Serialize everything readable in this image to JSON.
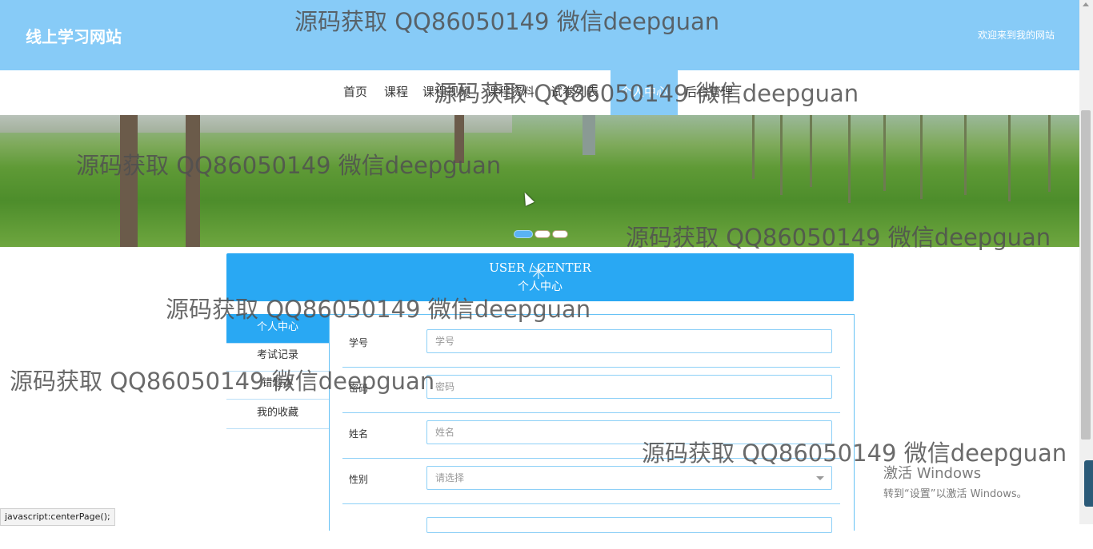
{
  "header": {
    "site_title": "线上学习网站",
    "welcome": "欢迎来到我的网站"
  },
  "nav": {
    "items": [
      {
        "label": "首页"
      },
      {
        "label": "课程"
      },
      {
        "label": "课程视频"
      },
      {
        "label": "课程资料"
      },
      {
        "label": "试卷列表"
      },
      {
        "label": "个人中心",
        "active": true
      },
      {
        "label": "后台管理"
      }
    ]
  },
  "banner": {
    "slide_count": 3,
    "active_slide": 1
  },
  "user_center": {
    "title_en": "USER / CENTER",
    "title_cn": "个人中心"
  },
  "side_menu": {
    "items": [
      {
        "label": "个人中心",
        "active": true
      },
      {
        "label": "考试记录"
      },
      {
        "label": "错题本"
      },
      {
        "label": "我的收藏"
      }
    ]
  },
  "form": {
    "fields": [
      {
        "label": "学号",
        "placeholder": "学号"
      },
      {
        "label": "密码",
        "placeholder": "密码"
      },
      {
        "label": "姓名",
        "placeholder": "姓名"
      },
      {
        "label": "性别",
        "placeholder": "请选择"
      }
    ]
  },
  "watermark": {
    "text": "源码获取 QQ86050149 微信deepguan"
  },
  "windows_activation": {
    "title": "激活 Windows",
    "subtitle": "转到“设置”以激活 Windows。"
  },
  "status_bar": {
    "text": "javascript:centerPage();"
  },
  "colors": {
    "header_bg": "#87cbf7",
    "accent_blue": "#29a8f3"
  }
}
